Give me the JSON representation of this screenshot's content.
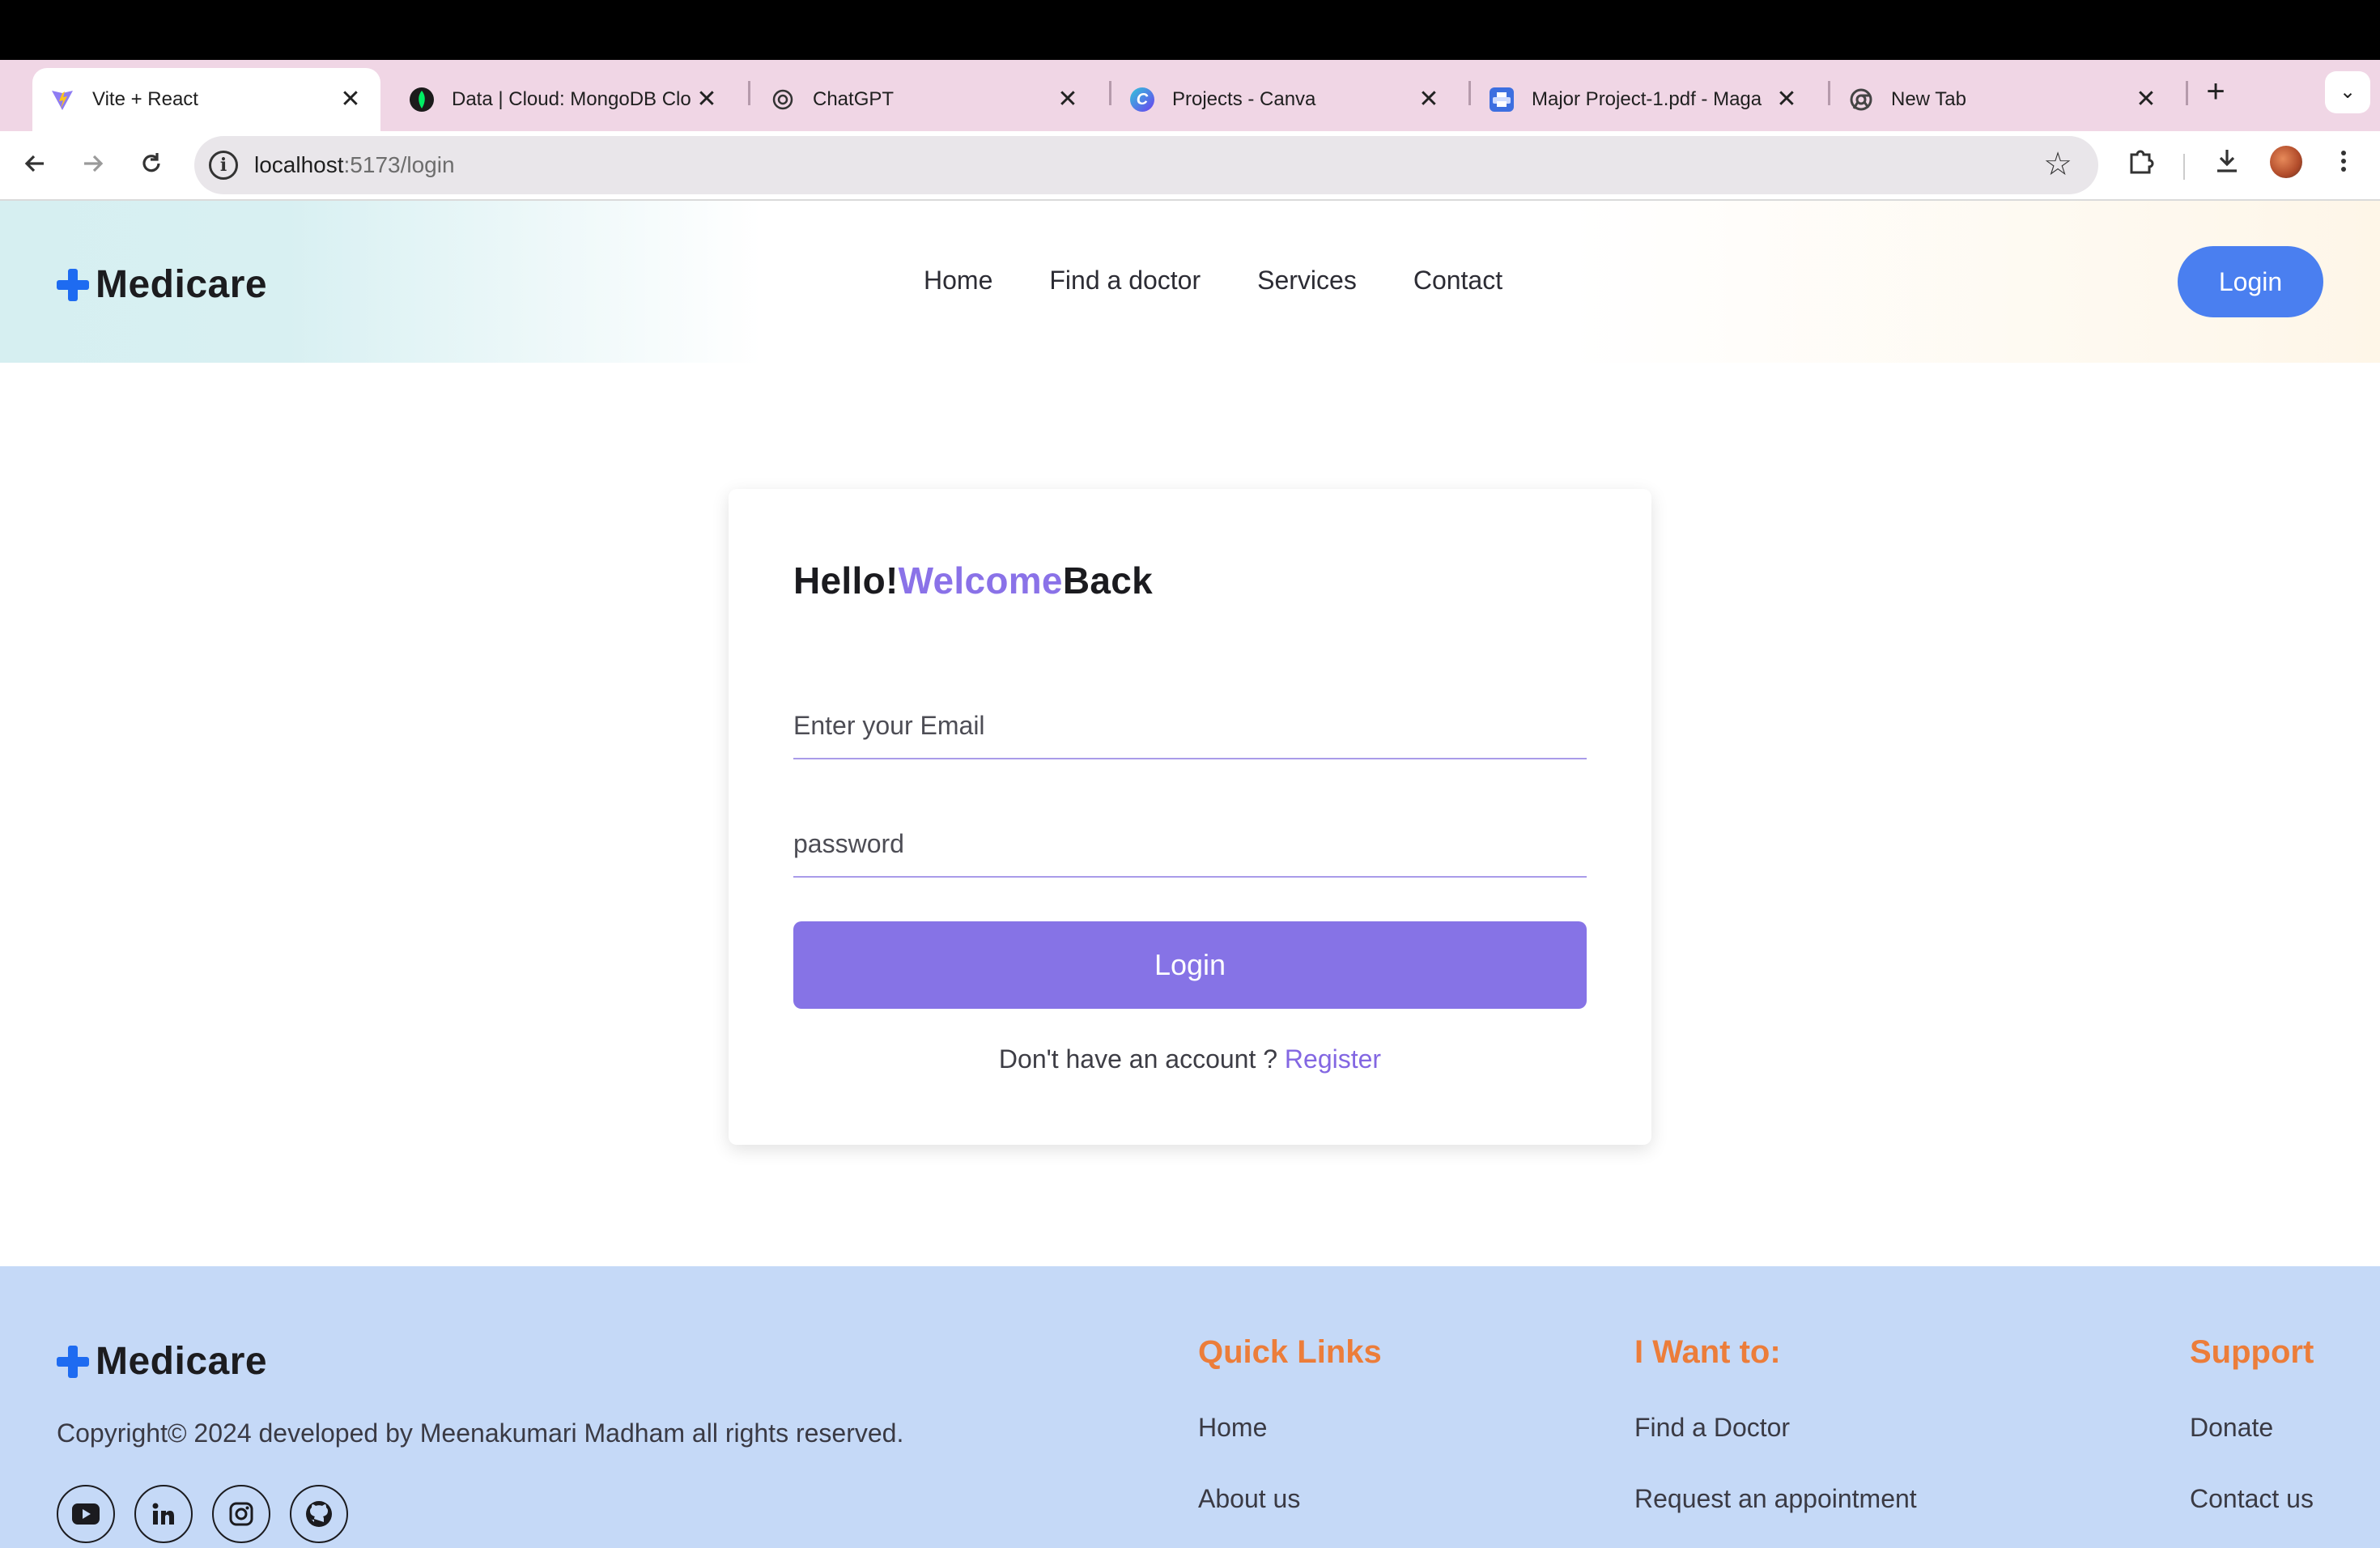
{
  "browser": {
    "tabs": [
      {
        "title": "Vite + React",
        "icon": "vite-icon",
        "active": true
      },
      {
        "title": "Data | Cloud: MongoDB Clo",
        "icon": "mongodb-leaf-icon",
        "active": false
      },
      {
        "title": "ChatGPT",
        "icon": "chatgpt-icon",
        "active": false
      },
      {
        "title": "Projects - Canva",
        "icon": "canva-icon",
        "active": false
      },
      {
        "title": "Major Project-1.pdf - Maga",
        "icon": "pdf-printer-icon",
        "active": false
      },
      {
        "title": "New Tab",
        "icon": "chrome-icon",
        "active": false
      }
    ],
    "close_glyph": "✕",
    "new_tab_glyph": "+",
    "tab_menu_glyph": "⌄",
    "url_host": "localhost",
    "url_path": ":5173/login"
  },
  "header": {
    "logo_text": "Medicare",
    "nav": [
      "Home",
      "Find a doctor",
      "Services",
      "Contact"
    ],
    "login_label": "Login"
  },
  "card": {
    "title_part1": "Hello!",
    "title_accent": "Welcome",
    "title_part2": "Back",
    "email_placeholder": "Enter your Email",
    "password_placeholder": "password",
    "login_label": "Login",
    "no_account_text": "Don't have an account ?",
    "register_label": "Register"
  },
  "footer": {
    "logo_text": "Medicare",
    "copyright": "Copyright© 2024 developed by Meenakumari Madham all rights reserved.",
    "socials": [
      "youtube-icon",
      "linkedin-icon",
      "instagram-icon",
      "github-icon"
    ],
    "quick_links": {
      "heading": "Quick Links",
      "items": [
        "Home",
        "About us"
      ]
    },
    "i_want_to": {
      "heading": "I Want to:",
      "items": [
        "Find a Doctor",
        "Request an appointment"
      ]
    },
    "support": {
      "heading": "Support",
      "items": [
        "Donate",
        "Contact us"
      ]
    }
  },
  "colors": {
    "brand_blue": "#1e6bf1",
    "header_login_bg": "#4a7ff0",
    "primary_purple": "#8673e6",
    "footer_bg": "#c5d9f7",
    "footer_heading": "#ec7d3a"
  }
}
